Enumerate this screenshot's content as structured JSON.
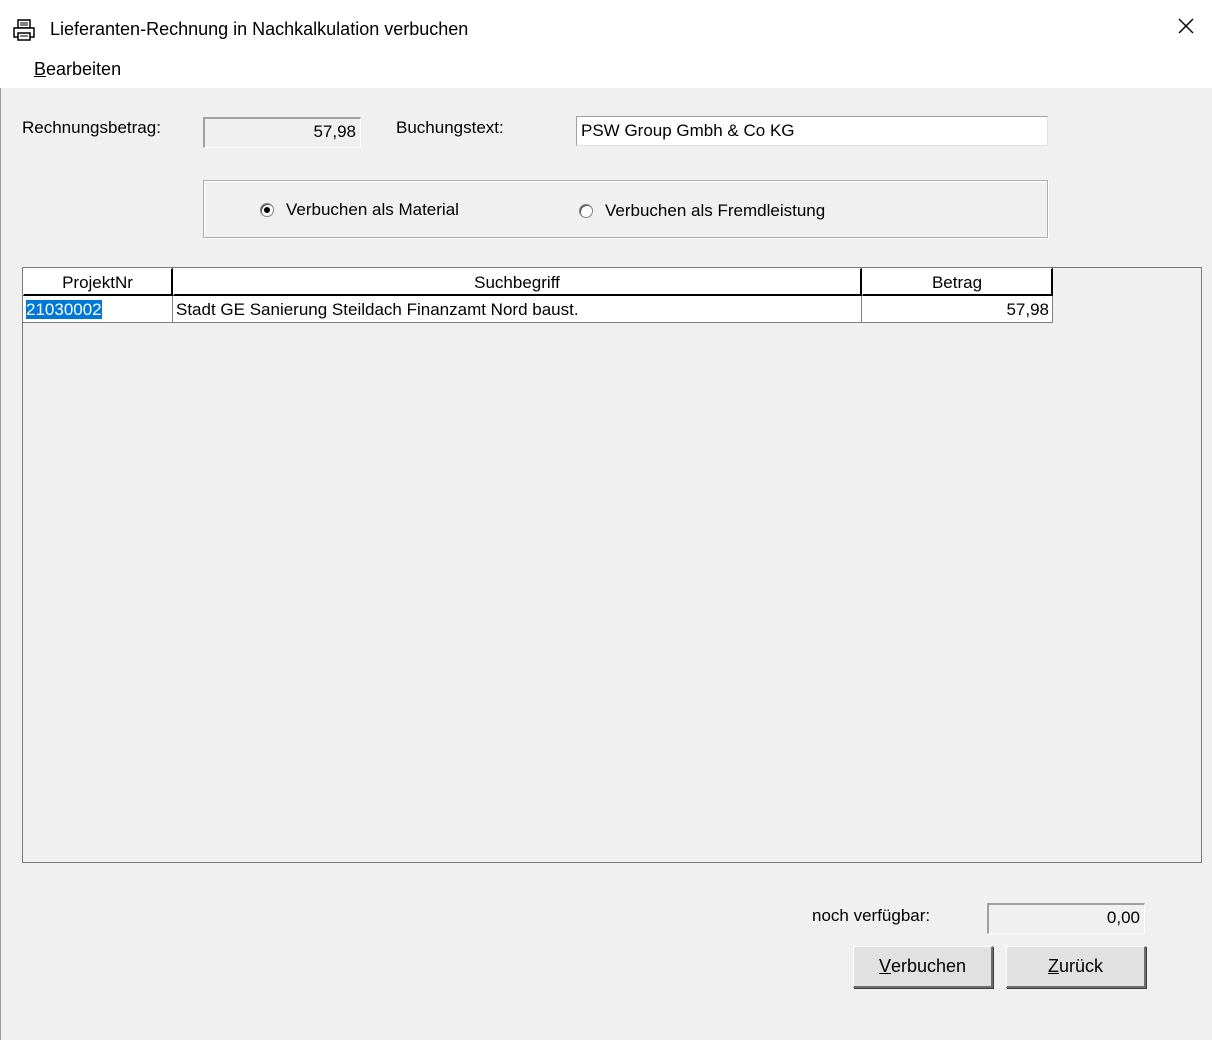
{
  "window": {
    "title": "Lieferanten-Rechnung in Nachkalkulation verbuchen",
    "icon": "printer-document-icon",
    "close_icon": "close-icon"
  },
  "menu": {
    "items": [
      {
        "label_accel": "B",
        "label_rest": "earbeiten"
      }
    ]
  },
  "form": {
    "rechnungsbetrag_label": "Rechnungsbetrag:",
    "rechnungsbetrag_value": "57,98",
    "buchungstext_label": "Buchungstext:",
    "buchungstext_value": "PSW Group Gmbh & Co KG"
  },
  "options": {
    "material_label": "Verbuchen als Material",
    "material_checked": true,
    "fremdleistung_label": "Verbuchen als Fremdleistung",
    "fremdleistung_checked": false
  },
  "grid": {
    "columns": [
      "ProjektNr",
      "Suchbegriff",
      "Betrag"
    ],
    "rows": [
      {
        "projektnr": "21030002",
        "suchbegriff": "Stadt GE Sanierung Steildach Finanzamt Nord baust.",
        "betrag": "57,98"
      }
    ]
  },
  "footer": {
    "noch_verfuegbar_label": "noch verfügbar:",
    "noch_verfuegbar_value": "0,00",
    "verbuchen_accel": "V",
    "verbuchen_rest": "erbuchen",
    "zurueck_accel": "Z",
    "zurueck_rest": "urück"
  }
}
